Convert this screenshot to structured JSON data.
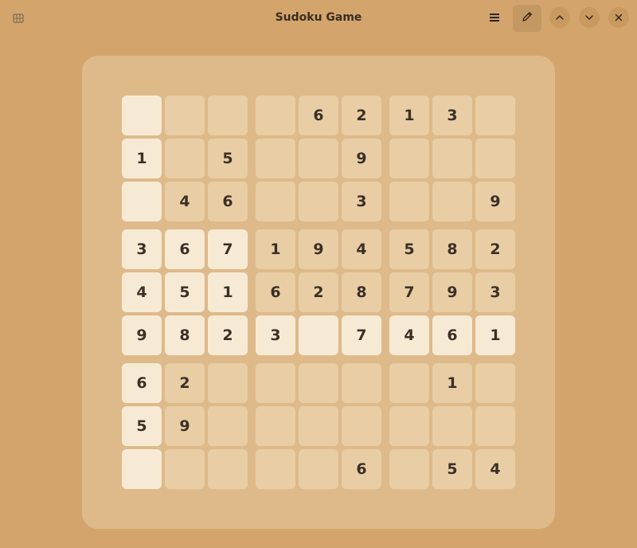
{
  "window": {
    "title": "Sudoku Game"
  },
  "grid": {
    "values": [
      [
        "",
        "",
        "",
        "",
        "6",
        "2",
        "1",
        "3",
        ""
      ],
      [
        "1",
        "",
        "5",
        "",
        "",
        "9",
        "",
        "",
        ""
      ],
      [
        "",
        "4",
        "6",
        "",
        "",
        "3",
        "",
        "",
        "9"
      ],
      [
        "3",
        "6",
        "7",
        "1",
        "9",
        "4",
        "5",
        "8",
        "2"
      ],
      [
        "4",
        "5",
        "1",
        "6",
        "2",
        "8",
        "7",
        "9",
        "3"
      ],
      [
        "9",
        "8",
        "2",
        "3",
        "",
        "7",
        "4",
        "6",
        "1"
      ],
      [
        "6",
        "2",
        "",
        "",
        "",
        "",
        "",
        "1",
        ""
      ],
      [
        "5",
        "9",
        "",
        "",
        "",
        "",
        "",
        "",
        ""
      ],
      [
        "",
        "",
        "",
        "",
        "",
        "6",
        "",
        "5",
        "4"
      ]
    ],
    "highlighted": [
      [
        1,
        0,
        0,
        0,
        0,
        0,
        0,
        0,
        0
      ],
      [
        1,
        0,
        0,
        0,
        0,
        0,
        0,
        0,
        0
      ],
      [
        1,
        0,
        0,
        0,
        0,
        0,
        0,
        0,
        0
      ],
      [
        1,
        1,
        1,
        0,
        0,
        0,
        0,
        0,
        0
      ],
      [
        1,
        1,
        1,
        0,
        0,
        0,
        0,
        0,
        0
      ],
      [
        1,
        1,
        1,
        1,
        1,
        1,
        1,
        1,
        1
      ],
      [
        1,
        0,
        0,
        0,
        0,
        0,
        0,
        0,
        0
      ],
      [
        1,
        0,
        0,
        0,
        0,
        0,
        0,
        0,
        0
      ],
      [
        1,
        0,
        0,
        0,
        0,
        0,
        0,
        0,
        0
      ]
    ]
  },
  "colors": {
    "window_bg": "#d3a56c",
    "board_bg": "#deba8a",
    "cell_bg": "#e9cda5",
    "cell_highlight": "#f7ead5",
    "text": "#3b3026"
  },
  "icons": {
    "app": "sudoku-app-icon",
    "menu": "hamburger-menu-icon",
    "pencil": "pencil-icon",
    "up": "chevron-up-icon",
    "down": "chevron-down-icon",
    "close": "close-icon"
  }
}
